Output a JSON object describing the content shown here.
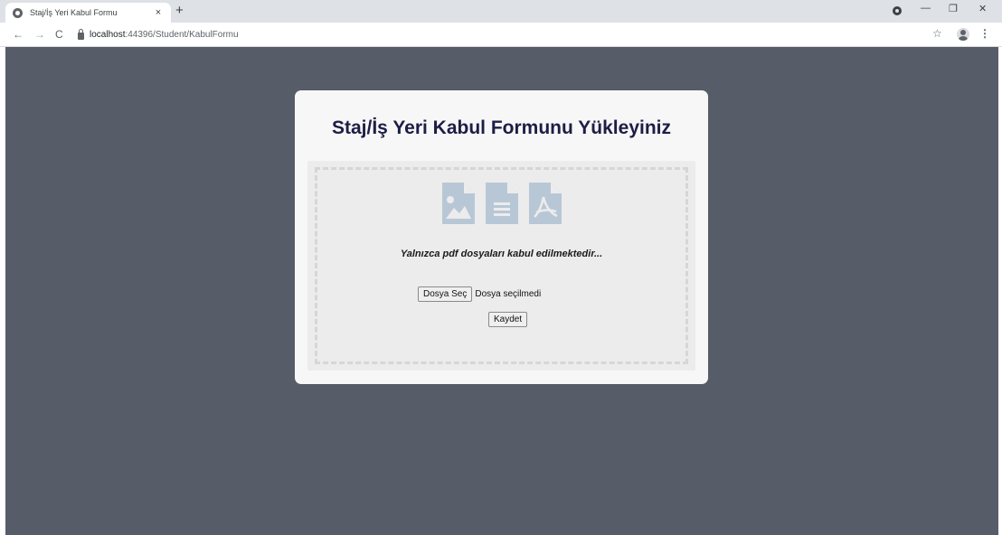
{
  "browser": {
    "tab_title": "Staj/İş Yeri Kabul Formu",
    "tab_close": "×",
    "new_tab": "+",
    "url_host": "localhost",
    "url_path": ":44396/Student/KabulFormu",
    "controls": {
      "minimize": "—",
      "restore": "❐",
      "close": "✕"
    },
    "icons": [
      "globe-icon",
      "back-icon",
      "forward-icon",
      "reload-icon",
      "lock-icon",
      "star-icon",
      "profile-icon",
      "menu-icon",
      "extension-icon"
    ]
  },
  "page": {
    "background": "#575c69",
    "card_title": "Staj/İş Yeri Kabul Formunu Yükleyiniz",
    "hint": "Yalnızca pdf dosyaları kabul edilmektedir...",
    "file_button": "Dosya Seç",
    "no_file_text": "Dosya seçilmedi",
    "save_button": "Kaydet",
    "file_type_icons": [
      "image-file-icon",
      "document-file-icon",
      "pdf-file-icon"
    ],
    "icon_color": "#b8c7d6",
    "title_color": "#1c1e45"
  }
}
